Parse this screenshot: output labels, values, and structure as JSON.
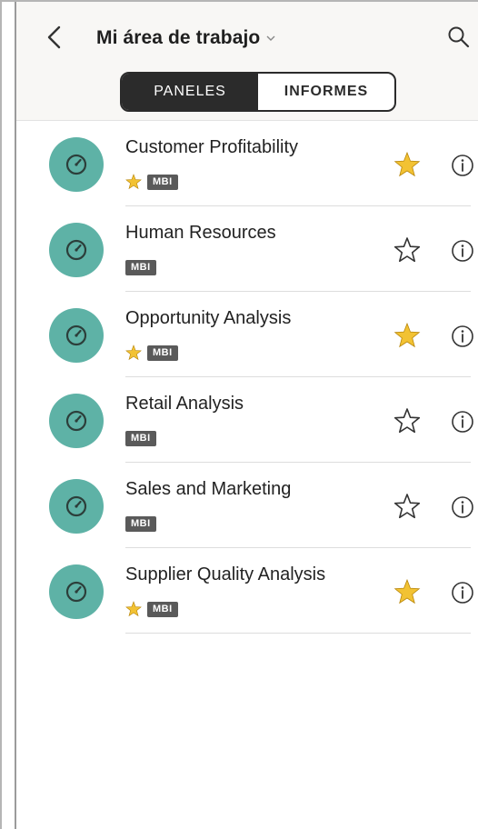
{
  "header": {
    "title": "Mi área de trabajo",
    "tabs": [
      {
        "label": "PANELES",
        "active": true
      },
      {
        "label": "INFORMES",
        "active": false
      }
    ]
  },
  "colors": {
    "accent_teal": "#5eb2a6",
    "star_gold": "#f2c233",
    "badge_gray": "#5a5a5a",
    "segment_dark": "#2b2b2b"
  },
  "icons": {
    "back": "chevron-left-icon",
    "search": "search-icon",
    "dashboard": "gauge-icon",
    "favorite": "star-icon",
    "info": "info-icon"
  },
  "dashboards": [
    {
      "title": "Customer Profitability",
      "badge": "MBI",
      "favorite": true
    },
    {
      "title": "Human Resources",
      "badge": "MBI",
      "favorite": false
    },
    {
      "title": "Opportunity Analysis",
      "badge": "MBI",
      "favorite": true
    },
    {
      "title": "Retail Analysis",
      "badge": "MBI",
      "favorite": false
    },
    {
      "title": "Sales and Marketing",
      "badge": "MBI",
      "favorite": false
    },
    {
      "title": "Supplier Quality Analysis",
      "badge": "MBI",
      "favorite": true
    }
  ]
}
